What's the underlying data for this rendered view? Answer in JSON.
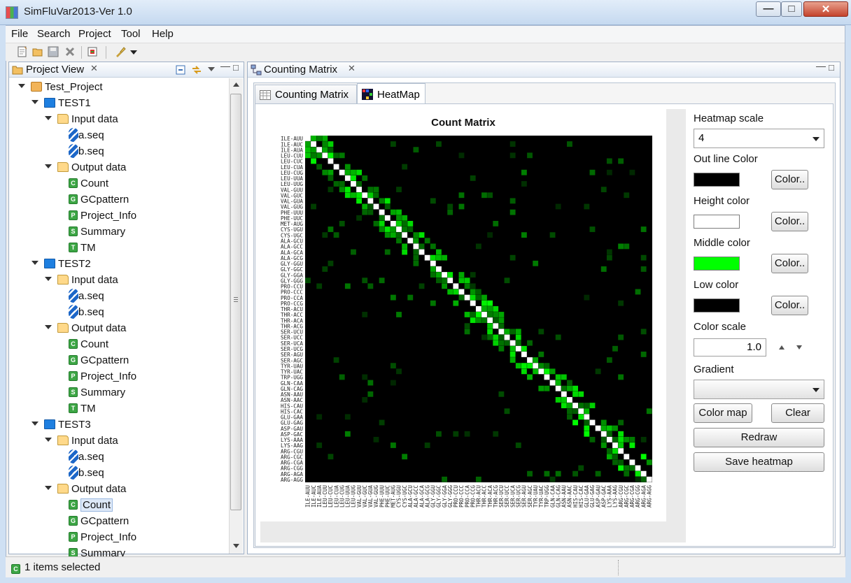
{
  "window": {
    "title": "SimFluVar2013-Ver 1.0"
  },
  "menu": [
    "File",
    "Search",
    "Project",
    "Tool",
    "Help"
  ],
  "toolbar_icons": [
    "new-file-icon",
    "open-folder-icon",
    "save-icon",
    "delete-icon",
    "export-icon",
    "run-icon",
    "dropdown-icon"
  ],
  "project_view": {
    "title": "Project View",
    "tree": [
      {
        "label": "Test_Project",
        "level": 0,
        "icon": "project",
        "twisty": true
      },
      {
        "label": "TEST1",
        "level": 1,
        "icon": "test",
        "twisty": true
      },
      {
        "label": "Input data",
        "level": 2,
        "icon": "folder",
        "twisty": true
      },
      {
        "label": "a.seq",
        "level": 3,
        "icon": "dna"
      },
      {
        "label": "b.seq",
        "level": 3,
        "icon": "dna"
      },
      {
        "label": "Output data",
        "level": 2,
        "icon": "folder",
        "twisty": true
      },
      {
        "label": "Count",
        "level": 3,
        "icon": "file",
        "letter": "C"
      },
      {
        "label": "GCpattern",
        "level": 3,
        "icon": "file",
        "letter": "G"
      },
      {
        "label": "Project_Info",
        "level": 3,
        "icon": "file",
        "letter": "P"
      },
      {
        "label": "Summary",
        "level": 3,
        "icon": "file",
        "letter": "S"
      },
      {
        "label": "TM",
        "level": 3,
        "icon": "file",
        "letter": "T"
      },
      {
        "label": "TEST2",
        "level": 1,
        "icon": "test",
        "twisty": true
      },
      {
        "label": "Input data",
        "level": 2,
        "icon": "folder",
        "twisty": true
      },
      {
        "label": "a.seq",
        "level": 3,
        "icon": "dna"
      },
      {
        "label": "b.seq",
        "level": 3,
        "icon": "dna"
      },
      {
        "label": "Output data",
        "level": 2,
        "icon": "folder",
        "twisty": true
      },
      {
        "label": "Count",
        "level": 3,
        "icon": "file",
        "letter": "C"
      },
      {
        "label": "GCpattern",
        "level": 3,
        "icon": "file",
        "letter": "G"
      },
      {
        "label": "Project_Info",
        "level": 3,
        "icon": "file",
        "letter": "P"
      },
      {
        "label": "Summary",
        "level": 3,
        "icon": "file",
        "letter": "S"
      },
      {
        "label": "TM",
        "level": 3,
        "icon": "file",
        "letter": "T"
      },
      {
        "label": "TEST3",
        "level": 1,
        "icon": "test",
        "twisty": true
      },
      {
        "label": "Input data",
        "level": 2,
        "icon": "folder",
        "twisty": true
      },
      {
        "label": "a.seq",
        "level": 3,
        "icon": "dna"
      },
      {
        "label": "b.seq",
        "level": 3,
        "icon": "dna"
      },
      {
        "label": "Output data",
        "level": 2,
        "icon": "folder",
        "twisty": true
      },
      {
        "label": "Count",
        "level": 3,
        "icon": "file",
        "letter": "C",
        "selected": true
      },
      {
        "label": "GCpattern",
        "level": 3,
        "icon": "file",
        "letter": "G"
      },
      {
        "label": "Project_Info",
        "level": 3,
        "icon": "file",
        "letter": "P"
      },
      {
        "label": "Summary",
        "level": 3,
        "icon": "file",
        "letter": "S"
      }
    ]
  },
  "editor": {
    "tab_title": "Counting Matrix",
    "inner_tabs": [
      "Counting Matrix",
      "HeatMap"
    ],
    "active_inner_tab": "HeatMap"
  },
  "heatmap": {
    "title": "Count Matrix",
    "codons": [
      "ILE-AUU",
      "ILE-AUC",
      "ILE-AUA",
      "LEU-CUU",
      "LEU-CUC",
      "LEU-CUA",
      "LEU-CUG",
      "LEU-UUA",
      "LEU-UUG",
      "VAL-GUU",
      "VAL-GUC",
      "VAL-GUA",
      "VAL-GUG",
      "PHE-UUU",
      "PHE-UUC",
      "MET-AUG",
      "CYS-UGU",
      "CYS-UGC",
      "ALA-GCU",
      "ALA-GCC",
      "ALA-GCA",
      "ALA-GCG",
      "GLY-GGU",
      "GLY-GGC",
      "GLY-GGA",
      "GLY-GGG",
      "PRO-CCU",
      "PRO-CCC",
      "PRO-CCA",
      "PRO-CCG",
      "THR-ACU",
      "THR-ACC",
      "THR-ACA",
      "THR-ACG",
      "SER-UCU",
      "SER-UCC",
      "SER-UCA",
      "SER-UCG",
      "SER-AGU",
      "SER-AGC",
      "TYR-UAU",
      "TYR-UAC",
      "TRP-UGG",
      "GLN-CAA",
      "GLN-CAG",
      "ASN-AAU",
      "ASN-AAC",
      "HIS-CAU",
      "HIS-CAC",
      "GLU-GAA",
      "GLU-GAG",
      "ASP-GAU",
      "ASP-GAC",
      "LYS-AAA",
      "LYS-AAG",
      "ARG-CGU",
      "ARG-CGC",
      "ARG-CGA",
      "ARG-CGG",
      "ARG-AGA",
      "ARG-AGG"
    ],
    "colors": {
      "low": "#000000",
      "middle": "#00ff00",
      "high": "#ffffff",
      "outline": "#000000"
    }
  },
  "controls": {
    "heatmap_scale_label": "Heatmap scale",
    "heatmap_scale_value": "4",
    "outline_color_label": "Out line Color",
    "height_color_label": "Height color",
    "middle_color_label": "Middle color",
    "low_color_label": "Low color",
    "color_button": "Color..",
    "color_scale_label": "Color scale",
    "color_scale_value": "1.0",
    "gradient_label": "Gradient",
    "gradient_value": "",
    "color_map_button": "Color map",
    "clear_button": "Clear",
    "redraw_button": "Redraw",
    "save_heatmap_button": "Save heatmap"
  },
  "status": {
    "text": "1 items selected"
  }
}
